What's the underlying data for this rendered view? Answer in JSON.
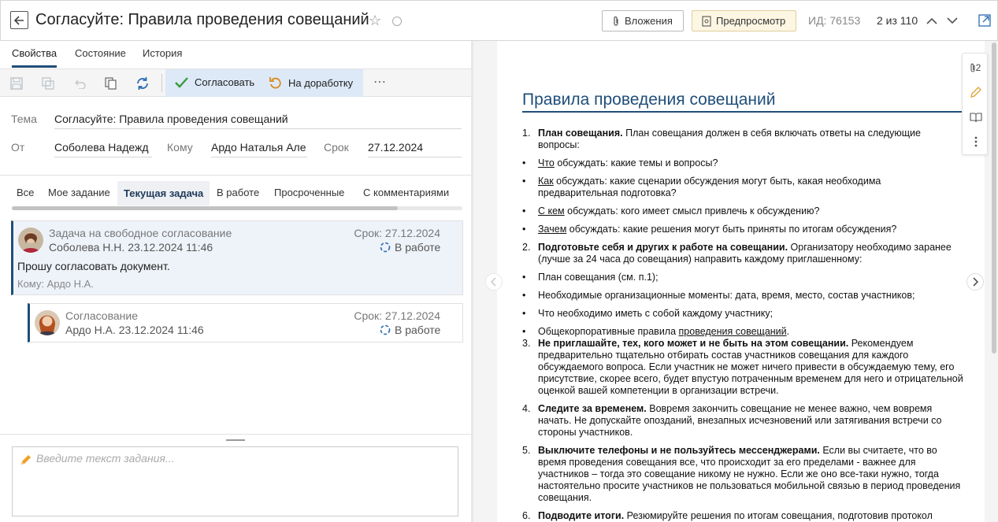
{
  "header": {
    "title": "Согласуйте: Правила проведения совещаний",
    "attachments_label": "Вложения",
    "preview_label": "Предпросмотр",
    "id_label": "ИД: 76153",
    "counter": "2 из 110"
  },
  "tabs": [
    {
      "label": "Свойства",
      "active": true
    },
    {
      "label": "Состояние",
      "active": false
    },
    {
      "label": "История",
      "active": false
    }
  ],
  "toolbar": {
    "approve_label": "Согласовать",
    "rework_label": "На доработку",
    "more_label": "⋯"
  },
  "form": {
    "subject_label": "Тема",
    "subject_value": "Согласуйте: Правила проведения совещаний",
    "from_label": "От",
    "from_value": "Соболева Надежд",
    "to_label": "Кому",
    "to_value": "Ардо Наталья Але",
    "due_label": "Срок",
    "due_value": "27.12.2024"
  },
  "filters": [
    {
      "label": "Все",
      "active": false
    },
    {
      "label": "Мое задание",
      "active": false
    },
    {
      "label": "Текущая задача",
      "active": true
    },
    {
      "label": "В работе",
      "active": false
    },
    {
      "label": "Просроченные",
      "active": false
    },
    {
      "label": "С комментариями",
      "active": false
    }
  ],
  "tasks": [
    {
      "title": "Задача на свободное согласование",
      "author_date": "Соболева Н.Н.  23.12.2024 11:46",
      "due": "Срок: 27.12.2024",
      "status": "В работе",
      "body": "Прошу согласовать документ.",
      "to": "Кому: Ардо Н.А."
    },
    {
      "title": "Согласование",
      "author_date": "Ардо Н.А.  23.12.2024 11:46",
      "due": "Срок: 27.12.2024",
      "status": "В работе"
    }
  ],
  "comment_input": {
    "placeholder": "Введите текст задания..."
  },
  "preview": {
    "attachments_count": "2",
    "doc_title": "Правила проведения совещаний",
    "items": [
      {
        "mark": "1.",
        "bold": "План совещания.",
        "text": " План совещания должен в себя включать ответы на следующие вопросы:"
      },
      {
        "mark": "•",
        "u": "Что",
        "text": " обсуждать: какие темы и вопросы?"
      },
      {
        "mark": "•",
        "u": "Как",
        "text": " обсуждать: какие сценарии обсуждения могут быть, какая необходима предварительная подготовка?"
      },
      {
        "mark": "•",
        "u": "С кем",
        "text": " обсуждать: кого имеет смысл привлечь к обсуждению?"
      },
      {
        "mark": "•",
        "u": "Зачем",
        "text": " обсуждать: какие решения могут быть приняты по итогам обсуждения?"
      },
      {
        "mark": "2.",
        "bold": "Подготовьте себя и других к работе на совещании.",
        "text": " Организатору необходимо заранее (лучше за 24 часа до совещания) направить каждому приглашенному:"
      },
      {
        "mark": "•",
        "text": "План совещания (см. п.1);"
      },
      {
        "mark": "•",
        "text": "Необходимые организационные моменты: дата, время, место, состав участников;"
      },
      {
        "mark": "•",
        "text": "Что необходимо иметь с собой каждому участнику;"
      },
      {
        "mark": "•",
        "text": "Общекорпоративные правила ",
        "u_tail": "проведения совещаний",
        "tail": "."
      },
      {
        "mark": "3.",
        "bold": "Не приглашайте, тех, кого может и не быть на этом совещании.",
        "text": " Рекомендуем предварительно тщательно отбирать состав участников совещания для каждого обсуждаемого вопроса. Если участник не может ничего привести в обсуждаемую тему, его присутствие, скорее всего, будет впустую потраченным временем для него и отрицательной оценкой вашей компетенции в организации встречи."
      },
      {
        "mark": "4.",
        "bold": "Следите за временем.",
        "text": " Вовремя закончить совещание не менее важно, чем вовремя начать. Не допускайте опозданий, внезапных исчезновений или затягивания встречи со стороны участников."
      },
      {
        "mark": "5.",
        "bold": "Выключите телефоны и не пользуйтесь мессенджерами.",
        "text": " Если вы считаете, что во время проведения совещания все, что происходит за его пределами - важнее для участников – тогда это совещание никому не нужно. Если же оно все-таки нужно, тогда настоятельно просите участников не пользоваться мобильной связью в период проведения совещания."
      },
      {
        "mark": "6.",
        "bold": "Подводите итоги.",
        "text": " Резюмируйте решения по итогам совещания, подготовив протокол"
      }
    ]
  }
}
